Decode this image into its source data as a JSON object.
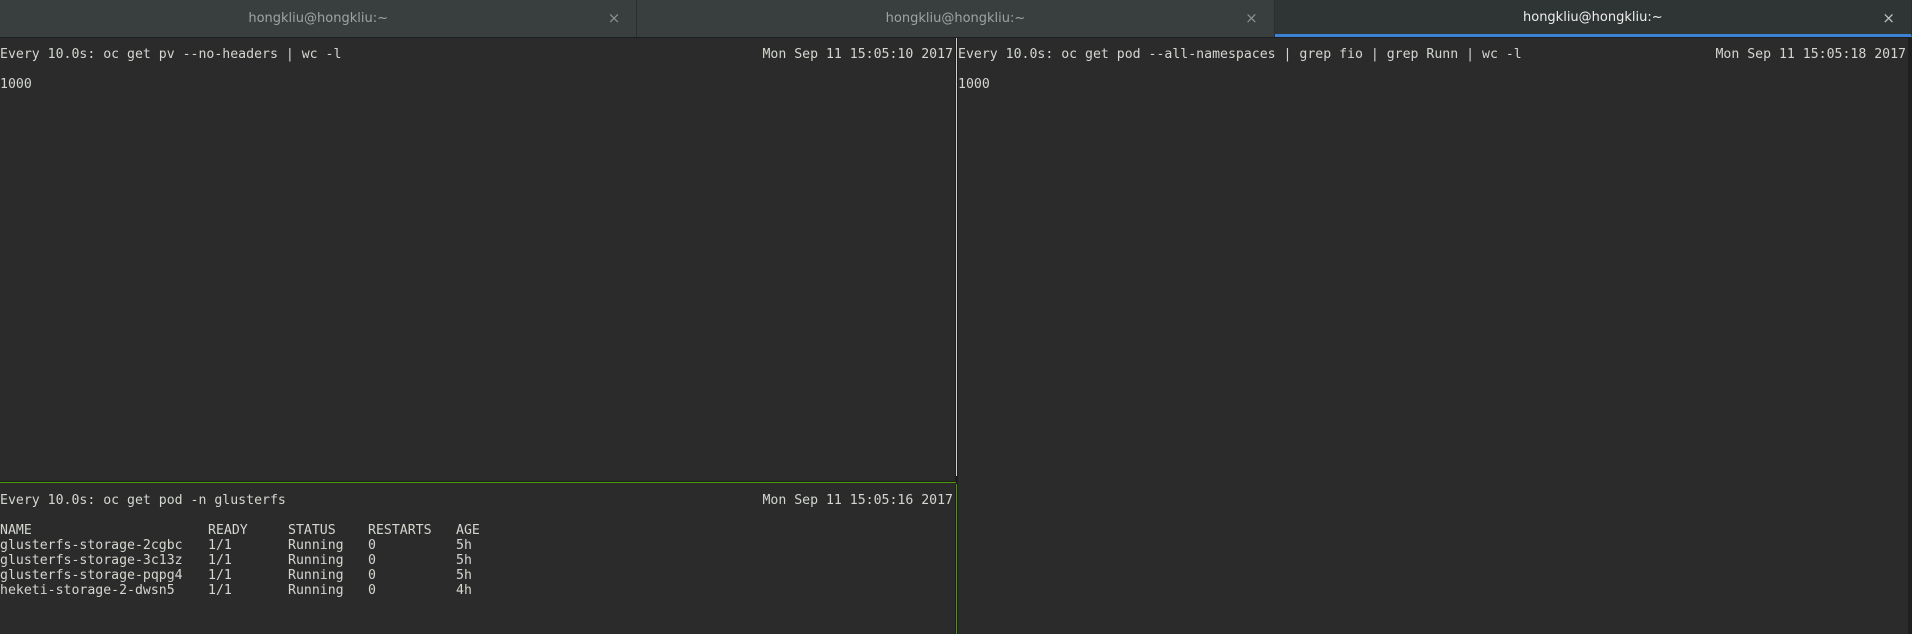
{
  "tabs": [
    {
      "title": "hongkliu@hongkliu:~",
      "active": false
    },
    {
      "title": "hongkliu@hongkliu:~",
      "active": false
    },
    {
      "title": "hongkliu@hongkliu:~",
      "active": true
    }
  ],
  "close_glyph": "×",
  "panes": {
    "top_left": {
      "command": "Every 10.0s: oc get pv --no-headers | wc -l",
      "timestamp": "Mon Sep 11 15:05:10 2017",
      "output": "1000"
    },
    "bottom_left": {
      "command": "Every 10.0s: oc get pod -n glusterfs",
      "timestamp": "Mon Sep 11 15:05:16 2017",
      "columns": [
        "NAME",
        "READY",
        "STATUS",
        "RESTARTS",
        "AGE"
      ],
      "rows": [
        [
          "glusterfs-storage-2cgbc",
          "1/1",
          "Running",
          "0",
          "5h"
        ],
        [
          "glusterfs-storage-3c13z",
          "1/1",
          "Running",
          "0",
          "5h"
        ],
        [
          "glusterfs-storage-pqpg4",
          "1/1",
          "Running",
          "0",
          "5h"
        ],
        [
          "heketi-storage-2-dwsn5",
          "1/1",
          "Running",
          "0",
          "4h"
        ]
      ]
    },
    "right": {
      "command": "Every 10.0s: oc get pod --all-namespaces | grep fio | grep Runn | wc -l",
      "timestamp": "Mon Sep 11 15:05:18 2017",
      "output": "1000"
    }
  },
  "colors": {
    "terminal_bg": "#2b2b2b",
    "terminal_fg": "#d3d7cf",
    "active_tab_underline": "#3d82d4",
    "active_split_border": "#4e9a06"
  }
}
